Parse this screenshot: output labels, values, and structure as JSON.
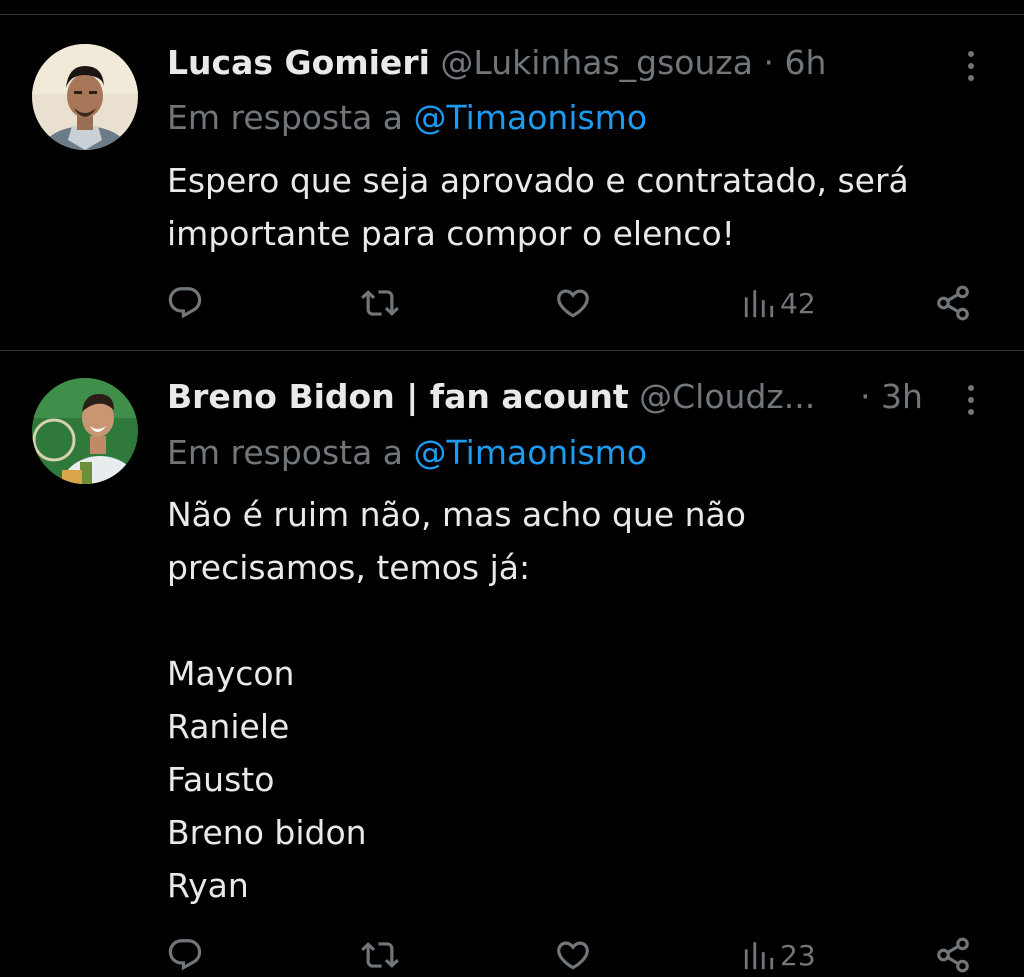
{
  "colors": {
    "background": "#000000",
    "text": "#e7e9ea",
    "muted": "#71767b",
    "link": "#1d9bf0",
    "divider": "#2f3336"
  },
  "tweets": [
    {
      "display_name": "Lucas Gomieri",
      "handle": "@Lukinhas_gsouza",
      "dot": "·",
      "time": "6h",
      "reply_prefix": "Em resposta a",
      "reply_handle": "@Timaonismo",
      "text": "Espero que seja aprovado e contratado, será\nimportante para compor o elenco!",
      "views": "42",
      "icons": [
        "more-icon",
        "reply-icon",
        "retweet-icon",
        "like-icon",
        "views-icon",
        "share-icon"
      ]
    },
    {
      "display_name": "Breno Bidon | fan acount",
      "handle": "@Cloudz...",
      "dot": "·",
      "time": "3h",
      "reply_prefix": "Em resposta a",
      "reply_handle": "@Timaonismo",
      "text": "Não é ruim não, mas acho que não\nprecisamos, temos já:\n\nMaycon\nRaniele\nFausto\nBreno bidon\nRyan",
      "views": "23",
      "icons": [
        "more-icon",
        "reply-icon",
        "retweet-icon",
        "like-icon",
        "views-icon",
        "share-icon"
      ]
    }
  ]
}
